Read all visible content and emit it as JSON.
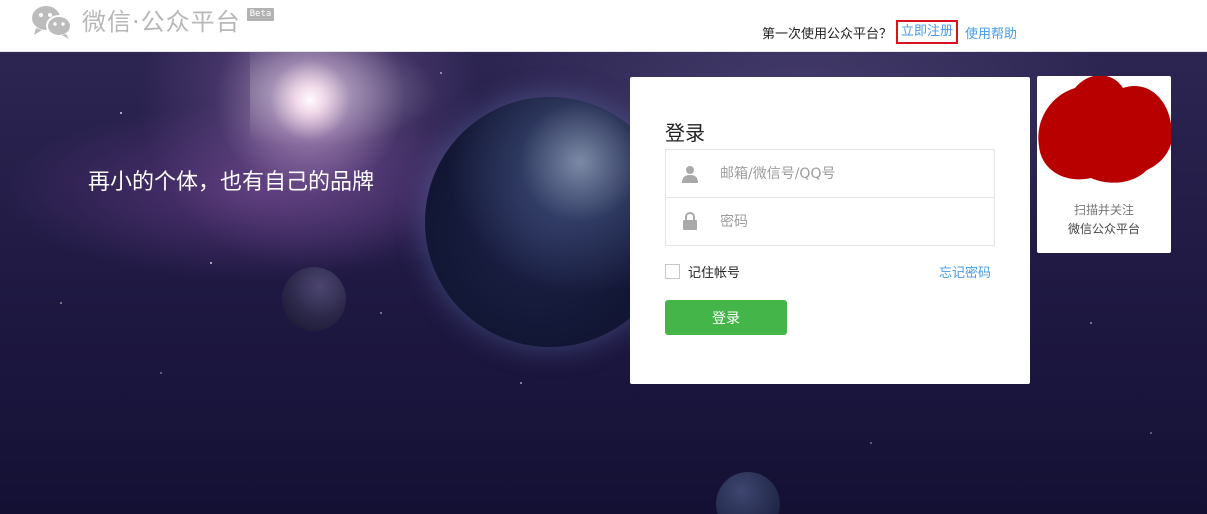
{
  "header": {
    "logo_icon": "wechat-logo-icon",
    "brand": "微信·公众平台",
    "beta_badge": "Beta",
    "first_time_text": "第一次使用公众平台？",
    "register_link": "立即注册",
    "help_link": "使用帮助"
  },
  "banner": {
    "slogan": "再小的个体，也有自己的品牌"
  },
  "login": {
    "title": "登录",
    "account_placeholder": "邮箱/微信号/QQ号",
    "password_placeholder": "密码",
    "remember_label": "记住帐号",
    "forgot_link": "忘记密码",
    "submit_label": "登录"
  },
  "qr": {
    "caption_line1": "扫描并关注",
    "caption_line2": "微信公众平台"
  },
  "colors": {
    "link": "#459ae9",
    "register_border": "#d9131c",
    "login_button": "#44b549",
    "redaction": "#b80000"
  }
}
